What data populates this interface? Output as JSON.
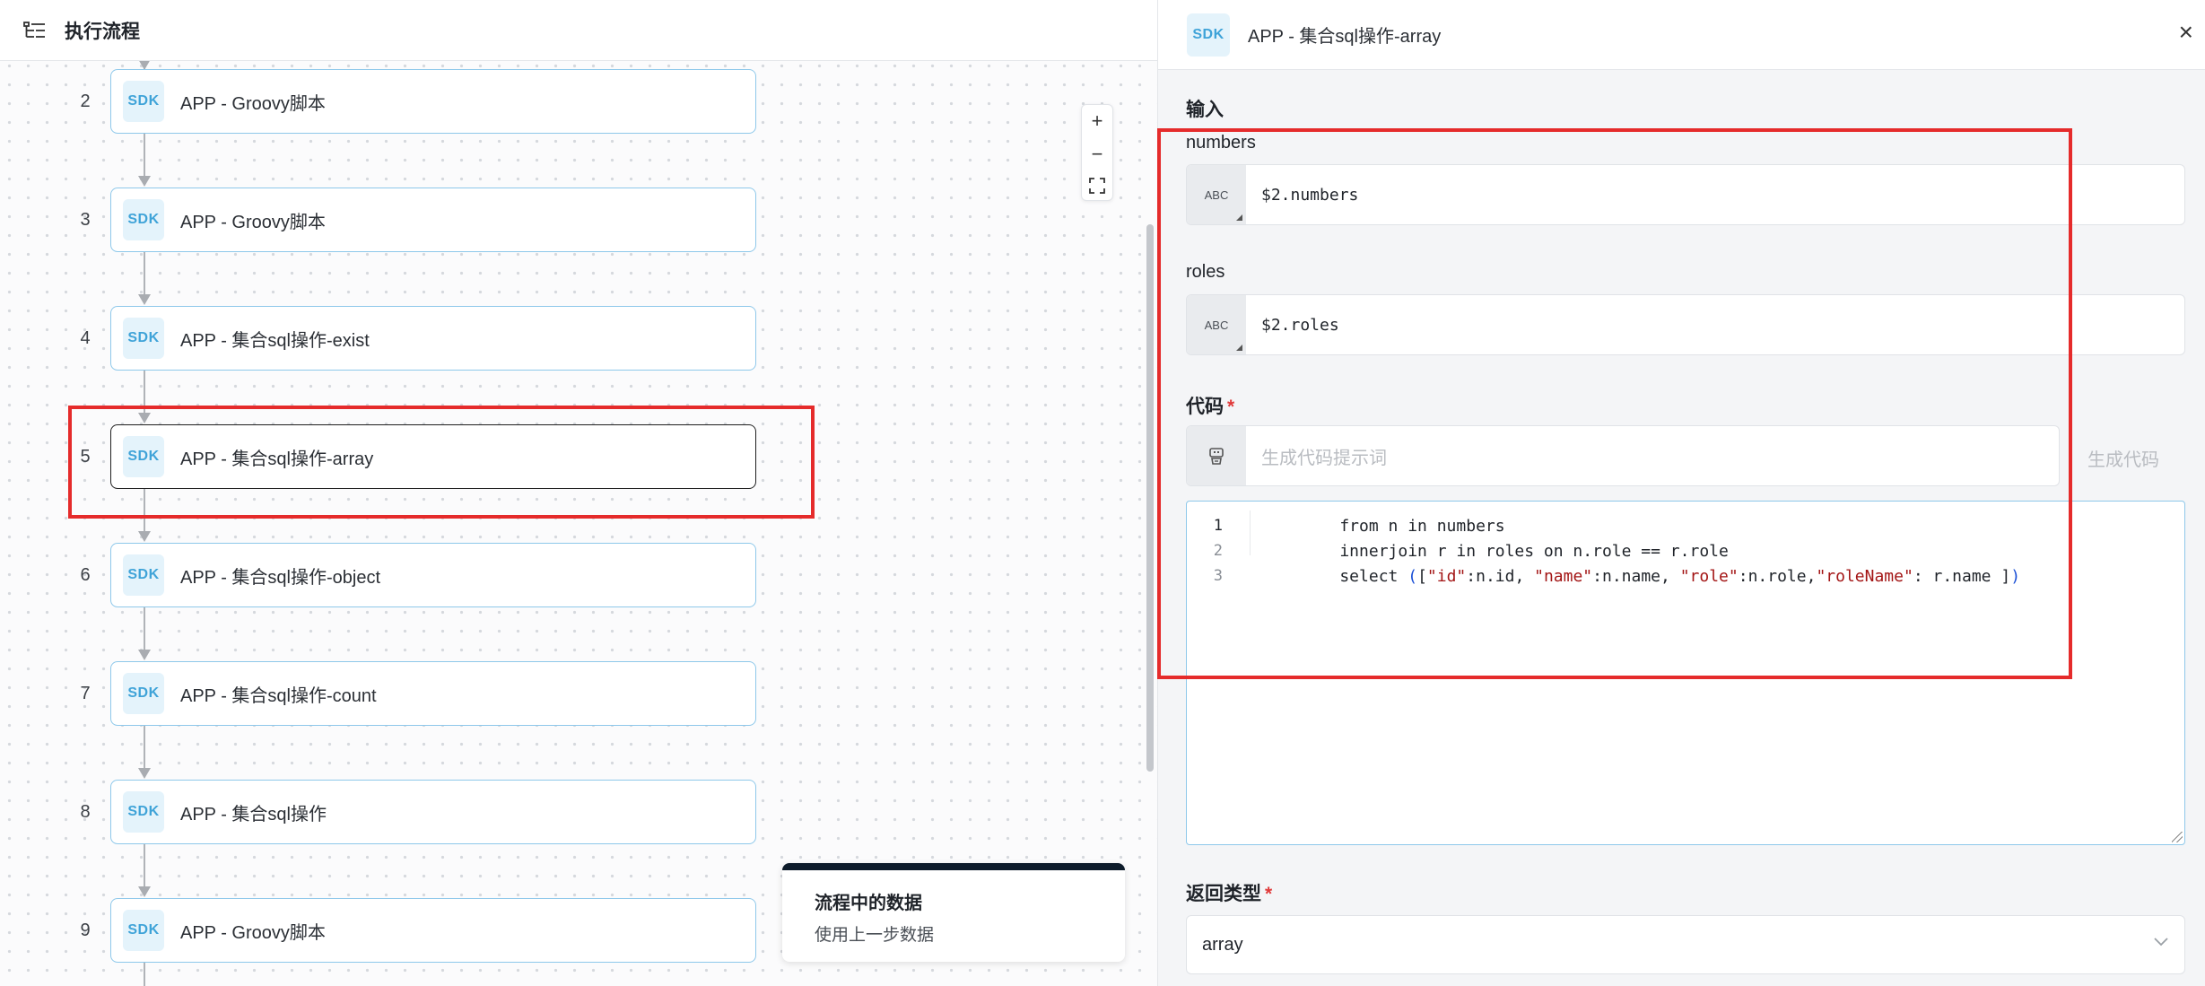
{
  "left_panel": {
    "title": "执行流程",
    "nodes": [
      {
        "step": "2",
        "badge": "SDK",
        "label": "APP - Groovy脚本"
      },
      {
        "step": "3",
        "badge": "SDK",
        "label": "APP - Groovy脚本"
      },
      {
        "step": "4",
        "badge": "SDK",
        "label": "APP - 集合sql操作-exist"
      },
      {
        "step": "5",
        "badge": "SDK",
        "label": "APP - 集合sql操作-array"
      },
      {
        "step": "6",
        "badge": "SDK",
        "label": "APP - 集合sql操作-object"
      },
      {
        "step": "7",
        "badge": "SDK",
        "label": "APP - 集合sql操作-count"
      },
      {
        "step": "8",
        "badge": "SDK",
        "label": "APP - 集合sql操作"
      },
      {
        "step": "9",
        "badge": "SDK",
        "label": "APP - Groovy脚本"
      }
    ],
    "zoom": {
      "in": "+",
      "out": "−",
      "fit": "⛶"
    },
    "hint_card": {
      "title": "流程中的数据",
      "description": "使用上一步数据"
    }
  },
  "right_panel": {
    "badge": "SDK",
    "title": "APP - 集合sql操作-array",
    "close": "×",
    "input_section": "输入",
    "fields": [
      {
        "label": "numbers",
        "type": "ABC",
        "value": "$2.numbers"
      },
      {
        "label": "roles",
        "type": "ABC",
        "value": "$2.roles"
      }
    ],
    "code": {
      "label": "代码",
      "required": "*",
      "prompt_placeholder": "生成代码提示词",
      "generate_button": "生成代码",
      "lines": [
        {
          "num": "1",
          "text": "    from n in numbers"
        },
        {
          "num": "2",
          "text": "    innerjoin r in roles on n.role == r.role"
        },
        {
          "num": "3",
          "text": "    select ([\"id\":n.id, \"name\":n.name, \"role\":n.role,\"roleName\": r.name ])"
        }
      ]
    },
    "return_type": {
      "label": "返回类型",
      "required": "*",
      "value": "array"
    }
  },
  "colors": {
    "highlight_box": "#e52b2b",
    "node_border": "#8ec8ea",
    "sdk_badge_bg": "#e4f3fb",
    "sdk_badge_text": "#3fa3d8",
    "string_token": "#a31515",
    "bracket_token": "#1a4fd6"
  }
}
